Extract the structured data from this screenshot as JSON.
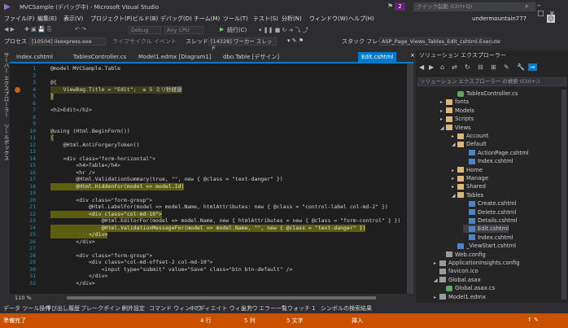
{
  "titlebar": {
    "title": "MVCSample (デバッグ中) - Microsoft Visual Studio",
    "notif": "2",
    "quick_launch": "クイック起動 (Ctrl+Q)"
  },
  "menu": [
    "ファイル(F)",
    "編集(E)",
    "表示(V)",
    "プロジェクト(P)",
    "ビルド(B)",
    "デバッグ(D)",
    "チーム(M)",
    "ツール(T)",
    "テスト(S)",
    "分析(N)",
    "ウィンドウ(W)",
    "ヘルプ(H)"
  ],
  "user": "undermountain777",
  "toolbar": {
    "debug": "Debug",
    "cpu": "Any CPU",
    "continue": "続行(C)"
  },
  "toolbar2": {
    "process_label": "プロセス",
    "process": "[10504] iisexpress.exe",
    "lifecycle": "ライフサイクル イベント",
    "thread_label": "スレッド",
    "thread": "[14328] ワーカー スレッド",
    "stack_label": "スタック フレーム",
    "stack": "ASP_Page_Views_Tables_Edit_cshtml.Execute"
  },
  "leftstrip": {
    "a": "サーバー エクスプローラー",
    "b": "ツールボックス"
  },
  "tabs": [
    "Index.cshtml",
    "TablesController.cs",
    "Model1.edmx [Diagram1]",
    "dbo.Table [デザイン]",
    "Edit.cshtml"
  ],
  "code_lines": [
    {
      "n": "1",
      "t": "@model MVCSample.Table"
    },
    {
      "n": "2",
      "t": ""
    },
    {
      "n": "3",
      "t": "@{"
    },
    {
      "n": "4",
      "t": "    ViewBag.Title = \"Edit\";  ≤ 5 ミリ秒経過"
    },
    {
      "n": "5",
      "t": "}"
    },
    {
      "n": "6",
      "t": ""
    },
    {
      "n": "7",
      "t": "<h2>Edit</h2>"
    },
    {
      "n": "8",
      "t": ""
    },
    {
      "n": "9",
      "t": ""
    },
    {
      "n": "10",
      "t": "@using (Html.BeginForm())"
    },
    {
      "n": "11",
      "t": "{"
    },
    {
      "n": "12",
      "t": "    @Html.AntiForgeryToken()"
    },
    {
      "n": "13",
      "t": ""
    },
    {
      "n": "14",
      "t": "    <div class=\"form-horizontal\">"
    },
    {
      "n": "15",
      "t": "        <h4>Table</h4>"
    },
    {
      "n": "16",
      "t": "        <hr />"
    },
    {
      "n": "17",
      "t": "        @Html.ValidationSummary(true, \"\", new { @class = \"text-danger\" })"
    },
    {
      "n": "18",
      "t": "        @Html.HiddenFor(model => model.Id)"
    },
    {
      "n": "19",
      "t": ""
    },
    {
      "n": "20",
      "t": "        <div class=\"form-group\">"
    },
    {
      "n": "21",
      "t": "            @Html.LabelFor(model => model.Name, htmlAttributes: new { @class = \"control-label col-md-2\" })"
    },
    {
      "n": "22",
      "t": "            <div class=\"col-md-10\">"
    },
    {
      "n": "23",
      "t": "                @Html.EditorFor(model => model.Name, new { htmlAttributes = new { @class = \"form-control\" } })"
    },
    {
      "n": "24",
      "t": "                @Html.ValidationMessageFor(model => model.Name, \"\", new { @class = \"text-danger\" })"
    },
    {
      "n": "25",
      "t": "            </div>"
    },
    {
      "n": "26",
      "t": "        </div>"
    },
    {
      "n": "27",
      "t": ""
    },
    {
      "n": "28",
      "t": "        <div class=\"form-group\">"
    },
    {
      "n": "29",
      "t": "            <div class=\"col-md-offset-2 col-md-10\">"
    },
    {
      "n": "30",
      "t": "                <input type=\"submit\" value=\"Save\" class=\"btn btn-default\" />"
    },
    {
      "n": "31",
      "t": "            </div>"
    },
    {
      "n": "32",
      "t": "        </div>"
    }
  ],
  "zoom": "110 %",
  "solution": {
    "header": "ソリューション エクスプローラー",
    "search": "ソリューション エクスプローラー の検索 (Ctrl+;)",
    "items": [
      {
        "label": "TablesController.cs",
        "kind": "cs"
      },
      {
        "label": "fonts",
        "kind": "fold"
      },
      {
        "label": "Models",
        "kind": "fold"
      },
      {
        "label": "Scripts",
        "kind": "fold"
      },
      {
        "label": "Views",
        "kind": "fold"
      },
      {
        "label": "Account",
        "kind": "fold"
      },
      {
        "label": "Default",
        "kind": "fold"
      },
      {
        "label": "ActionPage.cshtml",
        "kind": "html"
      },
      {
        "label": "Index.cshtml",
        "kind": "html"
      },
      {
        "label": "Home",
        "kind": "fold"
      },
      {
        "label": "Manage",
        "kind": "fold"
      },
      {
        "label": "Shared",
        "kind": "fold"
      },
      {
        "label": "Tables",
        "kind": "fold"
      },
      {
        "label": "Create.cshtml",
        "kind": "html"
      },
      {
        "label": "Delete.cshtml",
        "kind": "html"
      },
      {
        "label": "Details.cshtml",
        "kind": "html"
      },
      {
        "label": "Edit.cshtml",
        "kind": "html"
      },
      {
        "label": "Index.cshtml",
        "kind": "html"
      },
      {
        "label": "_ViewStart.cshtml",
        "kind": "html"
      },
      {
        "label": "Web.config",
        "kind": "cfg"
      },
      {
        "label": "ApplicationInsights.config",
        "kind": "cfg"
      },
      {
        "label": "favicon.ico",
        "kind": "cfg"
      },
      {
        "label": "Global.asax",
        "kind": "cfg"
      },
      {
        "label": "Global.asax.cs",
        "kind": "cs"
      },
      {
        "label": "Model1.edmx",
        "kind": "cfg"
      }
    ]
  },
  "bottom_tabs": [
    "データ ツール操作",
    "呼び出し履歴",
    "ブレークポイント",
    "例外設定",
    "コマンド ウィンドウ",
    "イミディエイト ウィンドウ",
    "出力",
    "エラー一覧",
    "ウォッチ 1",
    "シンボルの検索結果"
  ],
  "status": {
    "ready": "準備完了",
    "line": "4 行",
    "col": "5 列",
    "ch": "5 文字",
    "mode": "挿入"
  }
}
